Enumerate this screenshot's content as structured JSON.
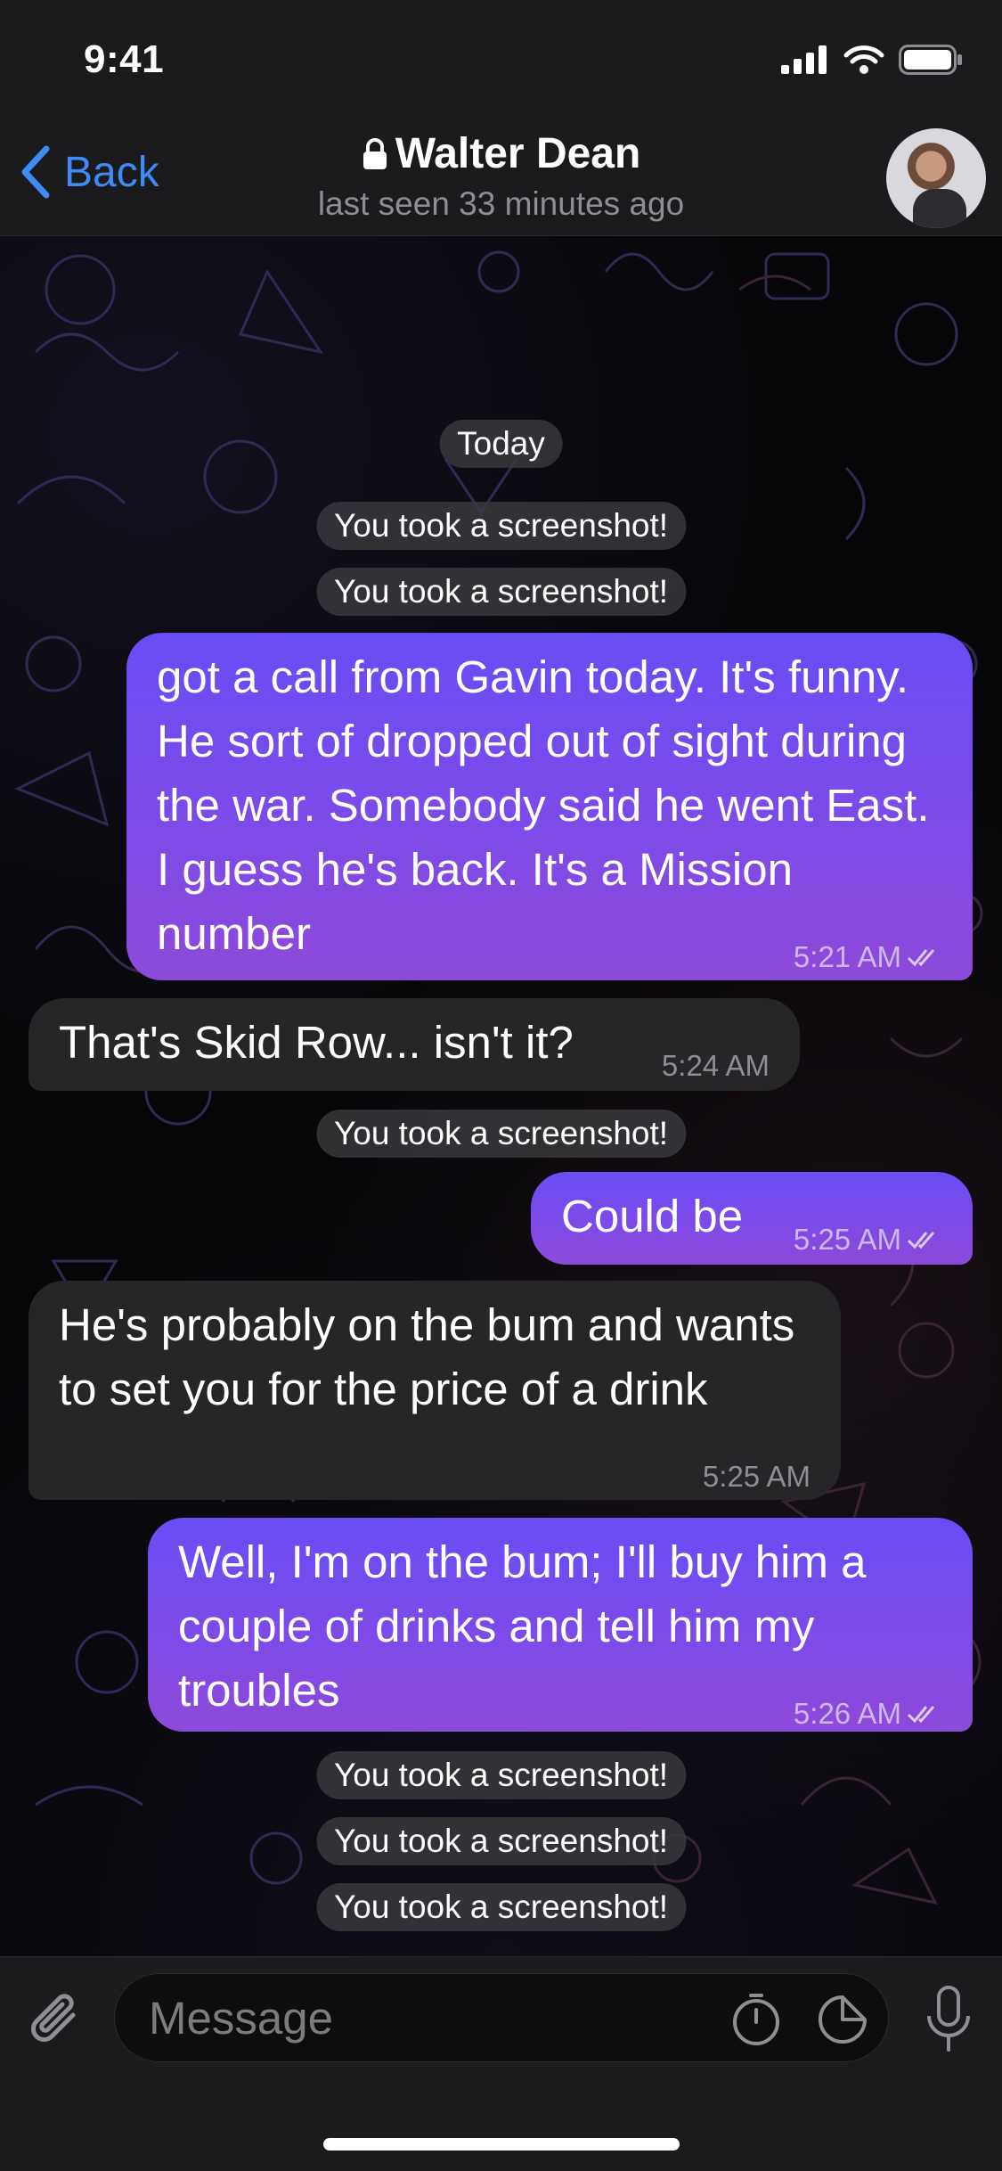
{
  "status_bar": {
    "time": "9:41"
  },
  "header": {
    "back_label": "Back",
    "title": "Walter Dean",
    "subtitle": "last seen 33 minutes ago"
  },
  "chat": {
    "date_divider": "Today",
    "service_message": "You took a screenshot!",
    "messages": [
      {
        "dir": "out",
        "text": "got a call from Gavin today. It's funny. He sort of dropped out of sight during the war. Somebody said he went East. I guess he's back. It's a Mission number",
        "time": "5:21 AM"
      },
      {
        "dir": "in",
        "text": "That's Skid Row... isn't it?",
        "time": "5:24 AM"
      },
      {
        "dir": "out",
        "text": "Could be",
        "time": "5:25 AM"
      },
      {
        "dir": "in",
        "text": "He's probably on the bum and wants to set you for the price of a drink",
        "time": "5:25 AM"
      },
      {
        "dir": "out",
        "text": "Well, I'm on the bum; I'll buy him a couple of drinks and tell him my troubles",
        "time": "5:26 AM"
      }
    ]
  },
  "input": {
    "placeholder": "Message"
  },
  "colors": {
    "accent": "#3e8cf3",
    "bubble_out_top": "#6a4cf5",
    "bubble_out_bottom": "#8d4ad9",
    "bubble_in": "#262629"
  },
  "icons": [
    "lock-icon",
    "signal-icon",
    "wifi-icon",
    "battery-icon",
    "back-chevron-icon",
    "paperclip-icon",
    "timer-icon",
    "sticker-icon",
    "microphone-icon",
    "double-check-icon"
  ]
}
